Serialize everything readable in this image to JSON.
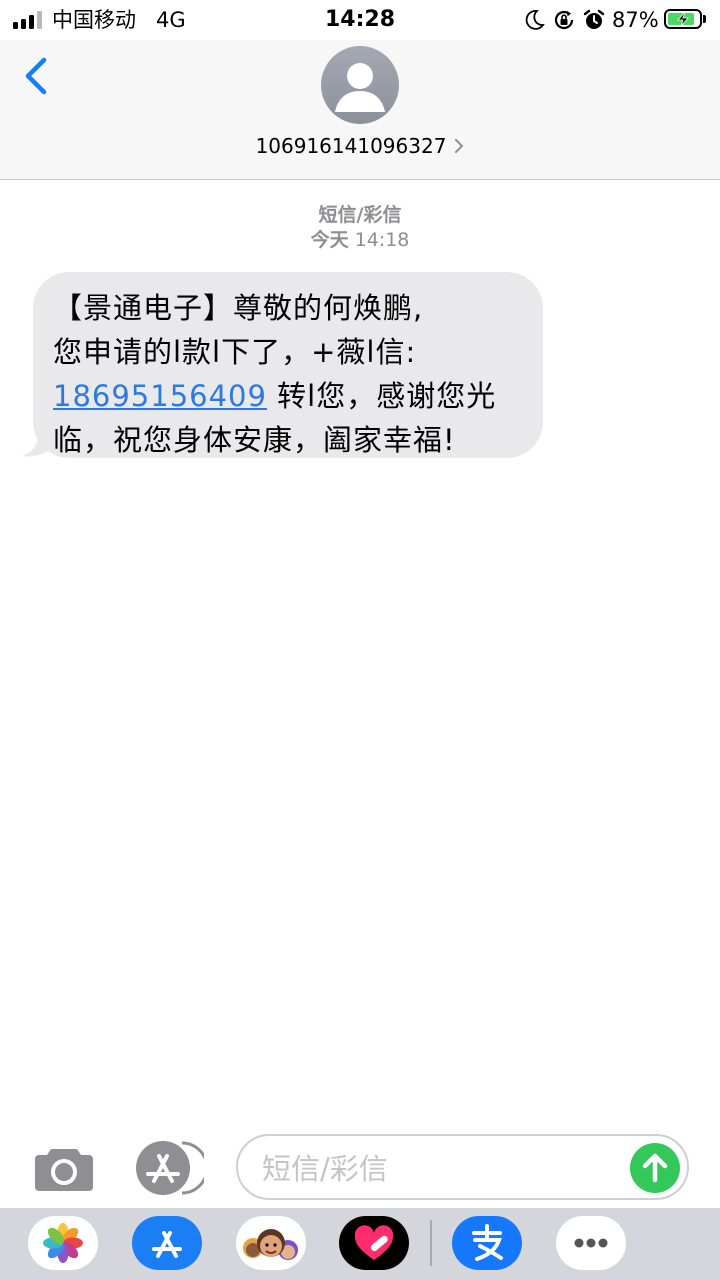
{
  "status_bar": {
    "carrier": "中国移动",
    "network": "4G",
    "time": "14:28",
    "battery_percent": "87%",
    "battery_level": 0.87,
    "icons": [
      "signal-bars-icon",
      "do-not-disturb-moon-icon",
      "rotation-lock-icon",
      "alarm-clock-icon",
      "battery-charging-icon"
    ]
  },
  "header": {
    "back_icon": "chevron-left-icon",
    "avatar_icon": "person-silhouette-icon",
    "contact_number": "106916141096327",
    "contact_chevron": "›"
  },
  "conversation": {
    "message_type": "短信/彩信",
    "timestamp_day": "今天",
    "timestamp_time": "14:18",
    "message": {
      "line1": "【景通电子】尊敬的何焕鹏,",
      "line2": "您申请的l款l下了，+薇l信:",
      "phone_link": "18695156409",
      "line3_rest": " 转l您，感谢您光",
      "line4": "临，祝您身体安康，阖家幸福!"
    }
  },
  "input_bar": {
    "placeholder": "短信/彩信",
    "camera_icon": "camera-icon",
    "apps_icon": "app-store-icon",
    "send_icon": "arrow-up-icon"
  },
  "app_drawer": {
    "apps": [
      "photos-icon",
      "app-store-icon",
      "memoji-icon",
      "digital-touch-icon",
      "alipay-icon",
      "more-icon"
    ]
  },
  "colors": {
    "link": "#2a7ae2",
    "ios_blue": "#147efb",
    "send_green": "#34c759",
    "bubble_gray": "#e9e9eb",
    "meta_gray": "#8e8e93"
  }
}
